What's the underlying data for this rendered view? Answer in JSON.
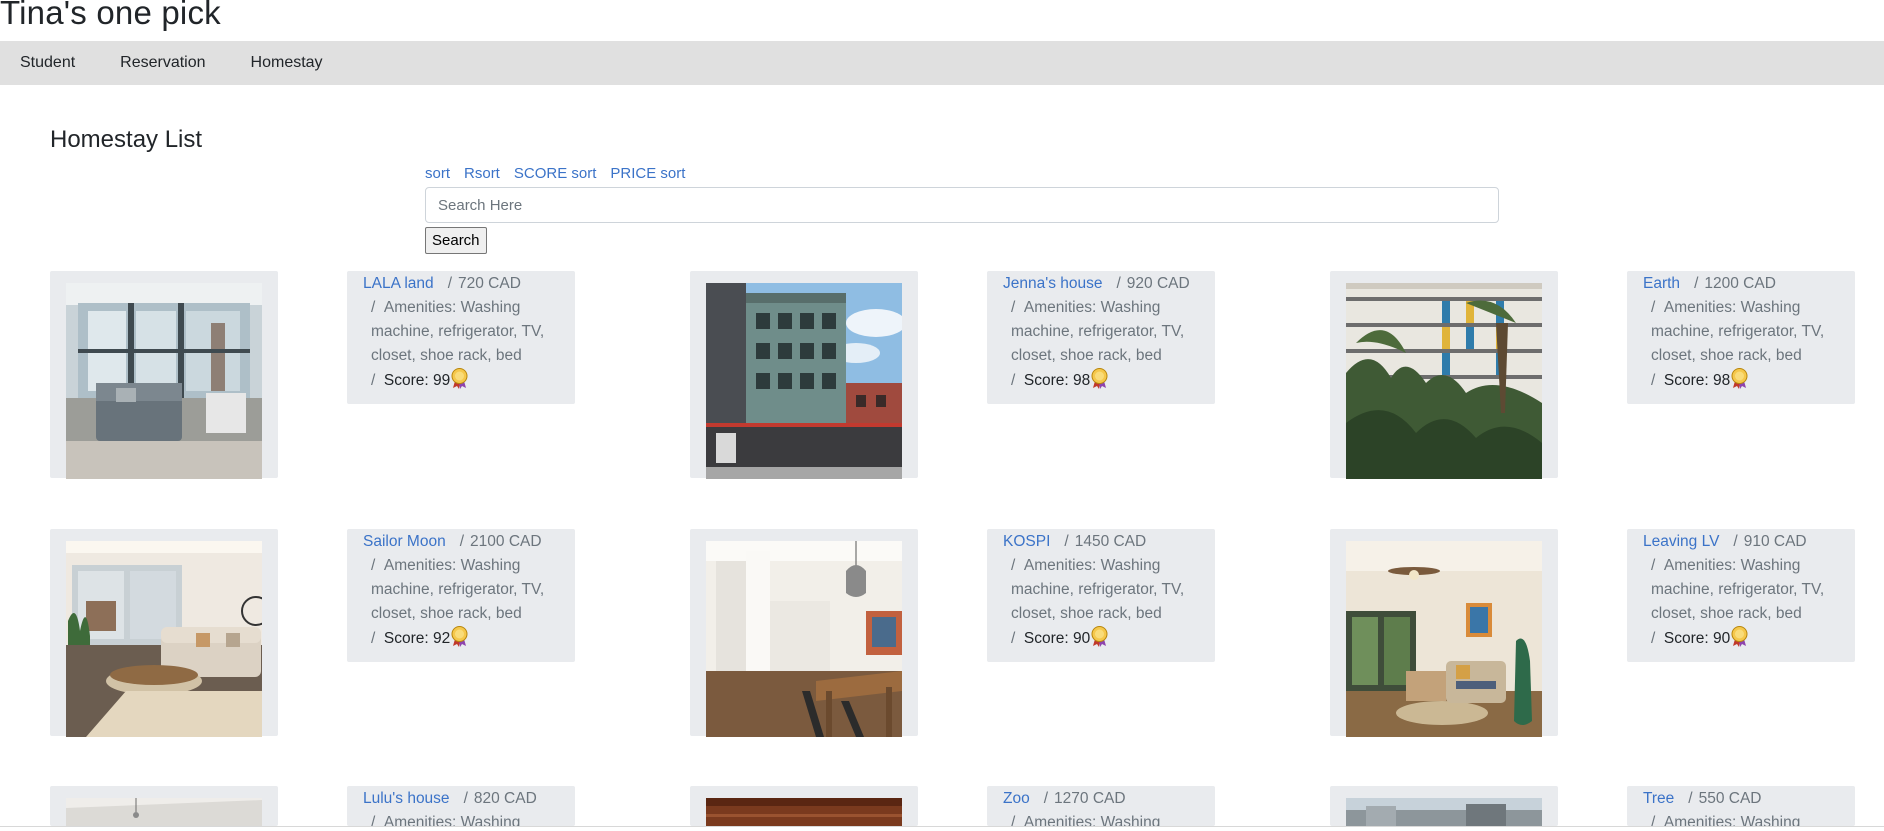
{
  "header": {
    "title": "Tina's one pick"
  },
  "nav": {
    "items": [
      {
        "label": "Student"
      },
      {
        "label": "Reservation"
      },
      {
        "label": "Homestay"
      }
    ]
  },
  "main": {
    "heading": "Homestay List",
    "sort_links": [
      {
        "label": "sort"
      },
      {
        "label": "Rsort"
      },
      {
        "label": "SCORE sort"
      },
      {
        "label": "PRICE sort"
      }
    ],
    "search": {
      "placeholder": "Search Here",
      "value": "",
      "button_label": "Search"
    },
    "homestays": [
      {
        "name": "LALA land",
        "price": "720 CAD",
        "amenities": "Amenities: Washing machine, refrigerator, TV, closet, shoe rack, bed",
        "score_label": "Score:",
        "score": "99"
      },
      {
        "name": "Jenna's house",
        "price": "920 CAD",
        "amenities": "Amenities: Washing machine, refrigerator, TV, closet, shoe rack, bed",
        "score_label": "Score:",
        "score": "98"
      },
      {
        "name": "Earth",
        "price": "1200 CAD",
        "amenities": "Amenities: Washing machine, refrigerator, TV, closet, shoe rack, bed",
        "score_label": "Score:",
        "score": "98"
      },
      {
        "name": "Sailor Moon",
        "price": "2100 CAD",
        "amenities": "Amenities: Washing machine, refrigerator, TV, closet, shoe rack, bed",
        "score_label": "Score:",
        "score": "92"
      },
      {
        "name": "KOSPI",
        "price": "1450 CAD",
        "amenities": "Amenities: Washing machine, refrigerator, TV, closet, shoe rack, bed",
        "score_label": "Score:",
        "score": "90"
      },
      {
        "name": "Leaving LV",
        "price": "910 CAD",
        "amenities": "Amenities: Washing machine, refrigerator, TV, closet, shoe rack, bed",
        "score_label": "Score:",
        "score": "90"
      },
      {
        "name": "Lulu's house",
        "price": "820 CAD",
        "amenities": "Amenities: Washing",
        "score_label": "",
        "score": ""
      },
      {
        "name": "Zoo",
        "price": "1270 CAD",
        "amenities": "Amenities: Washing",
        "score_label": "",
        "score": ""
      },
      {
        "name": "Tree",
        "price": "550 CAD",
        "amenities": "Amenities: Washing",
        "score_label": "",
        "score": ""
      }
    ]
  },
  "icons": {
    "score": "medal-icon"
  },
  "colors": {
    "link": "#3b73c8",
    "card_bg": "#e9ebee",
    "navbar_bg": "#e0e0e0"
  }
}
